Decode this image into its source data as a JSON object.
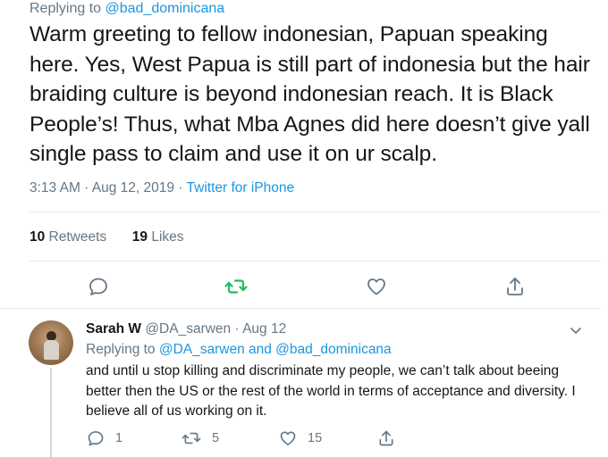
{
  "main_tweet": {
    "replying_prefix": "Replying to",
    "replying_handle": "@bad_dominicana",
    "text": "Warm greeting to fellow indonesian, Papuan speaking here. Yes, West Papua is still part of indonesia but the hair braiding culture is beyond indonesian reach. It is Black People’s! Thus, what Mba Agnes did here doesn’t give yall single pass to claim and use it on ur scalp.",
    "time": "3:13 AM · Aug 12, 2019 · ",
    "source": "Twitter for iPhone",
    "retweets_count": "10",
    "retweets_label": " Retweets",
    "likes_count": "19",
    "likes_label": " Likes",
    "icons": [
      "reply-icon",
      "retweet-icon",
      "like-icon",
      "share-icon"
    ],
    "retweet_color": "#17bf63"
  },
  "reply_tweet": {
    "name": "Sarah W",
    "handle_date": " @DA_sarwen · Aug 12",
    "replying_prefix": "Replying to ",
    "replying_handles": "@DA_sarwen and @bad_dominicana",
    "text": "and until u stop killing and discriminate my people, we can’t talk about beeing better then the US or the rest of the world in terms of acceptance and diversity. I believe all of us working on it.",
    "reply_count": "1",
    "retweet_count": "5",
    "like_count": "15"
  },
  "colors": {
    "link": "#1b95e0",
    "secondary_text": "#657786",
    "border": "#e6ecf0"
  }
}
